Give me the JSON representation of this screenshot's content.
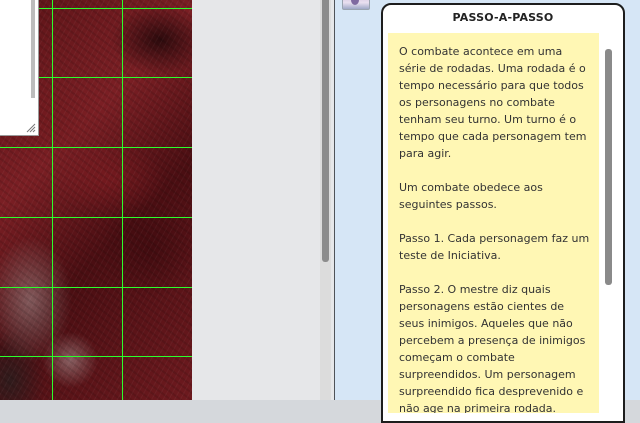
{
  "handout": {
    "title": "Passo-a-Passo",
    "paragraphs": [
      "O combate acontece em uma série de rodadas. Uma rodada é o tempo necessário para que todos os personagens no combate tenham seu turno. Um turno é o tempo que cada personagem tem para agir.",
      "Um combate obedece aos seguintes passos.",
      "Passo 1. Cada personagem faz um teste de Iniciativa.",
      "Passo 2. O mestre diz quais personagens estão cientes de seus inimigos. Aqueles que não percebem a presença de inimigos começam o combate surpreendidos. Um personagem surpreendido fica desprevenido e não age na primeira rodada."
    ]
  },
  "map": {
    "grid_color": "#2cff2c",
    "background_color": "#6e1a1f"
  },
  "colors": {
    "note_background": "#fff7b4",
    "right_panel_background": "#d6e6f6",
    "middle_panel_background": "#e6e7e9"
  },
  "icons": {
    "resize_grip": "resize-grip-icon",
    "avatar": "avatar-image"
  }
}
